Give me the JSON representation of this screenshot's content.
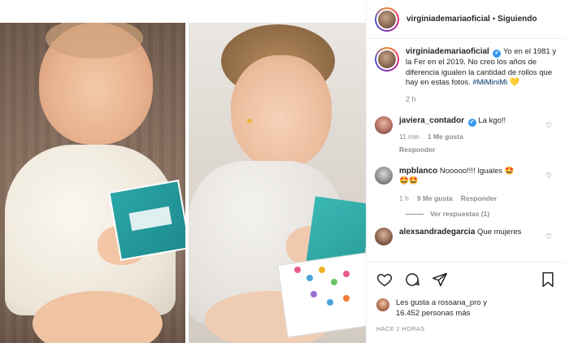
{
  "post": {
    "header": {
      "username": "virginiademariaoficial",
      "separator": "•",
      "follow_state": "Siguiendo",
      "more_icon": "ellipsis-icon"
    },
    "caption": {
      "username": "virginiademariaoficial",
      "text": "Yo en el 1981 y la Fer en el 2019. No creo los años de diferencia igualen la cantidad de rollos que hay en estas fotos. ",
      "hashtag": "#MiMiniMi",
      "emoji": "💛",
      "time": "2 h"
    },
    "comments": [
      {
        "username": "javiera_contador",
        "verified": true,
        "text": "La kgo!!",
        "time": "11 min",
        "likes": "1 Me gusta",
        "reply": "Responder"
      },
      {
        "username": "mpblanco",
        "verified": false,
        "text": "Nooooo!!!! Iguales 🤩",
        "emoji_line": "🤩🤩",
        "time": "1 h",
        "likes": "9 Me gusta",
        "reply": "Responder",
        "view_replies": "Ver respuestas (1)"
      },
      {
        "username": "alexsandradegarcia",
        "verified": false,
        "text": "Que mujeres"
      }
    ],
    "likes": {
      "line1": "Les gusta a rossana_pro y",
      "line2": "16.452 personas más"
    },
    "posted_time": "HACE 2 HORAS"
  },
  "icons": {
    "like": "heart-icon",
    "comment": "comment-icon",
    "share": "share-icon",
    "save": "bookmark-icon",
    "verified": "verified-badge-icon"
  },
  "colors": {
    "verified": "#3897f0",
    "hashtag": "#003569",
    "meta": "#8e8e8e",
    "text": "#262626"
  }
}
